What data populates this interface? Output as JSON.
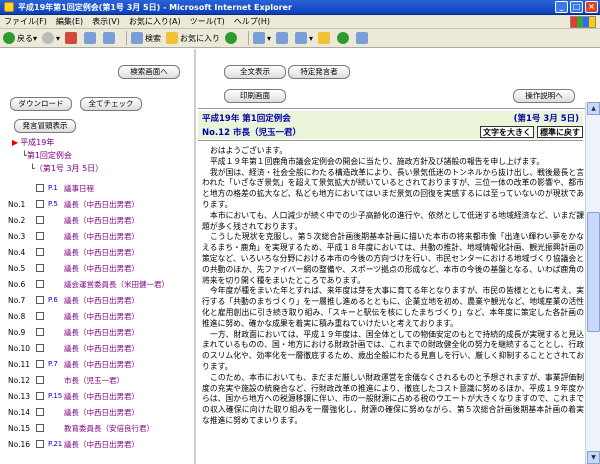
{
  "window": {
    "title": "平成19年第1回定例会(第1号 3月 5日) - Microsoft Internet Explorer"
  },
  "menu": [
    "ファイル(F)",
    "編集(E)",
    "表示(V)",
    "お気に入り(A)",
    "ツール(T)",
    "ヘルプ(H)"
  ],
  "toolbar": {
    "back": "戻る",
    "search": "検索",
    "favorites": "お気に入り"
  },
  "left": {
    "search_screen_btn": "検索画面へ",
    "download_btn": "ダウンロード",
    "check_all_btn": "全てチェック",
    "speaker_list_btn": "発言冒頭表示",
    "tree_year": "平成19年",
    "tree_session": "第1回定例会",
    "tree_date": "（第1号 3月 5日）",
    "rows": [
      {
        "no": "",
        "page": "P.1",
        "name": "議事日程"
      },
      {
        "no": "No.1",
        "page": "P.5",
        "name": "議長（中西日出男君）"
      },
      {
        "no": "No.2",
        "page": "",
        "name": "議長（中西日出男君）"
      },
      {
        "no": "No.3",
        "page": "",
        "name": "議長（中西日出男君）"
      },
      {
        "no": "No.4",
        "page": "",
        "name": "議長（中西日出男君）"
      },
      {
        "no": "No.5",
        "page": "",
        "name": "議長（中西日出男君）"
      },
      {
        "no": "No.6",
        "page": "",
        "name": "議会運営委員長（米田健一君）"
      },
      {
        "no": "No.7",
        "page": "P.6",
        "name": "議長（中西日出男君）"
      },
      {
        "no": "No.8",
        "page": "",
        "name": "議長（中西日出男君）"
      },
      {
        "no": "No.9",
        "page": "",
        "name": "議長（中西日出男君）"
      },
      {
        "no": "No.10",
        "page": "",
        "name": "議長（中西日出男君）"
      },
      {
        "no": "No.11",
        "page": "P.7",
        "name": "議長（中西日出男君）"
      },
      {
        "no": "No.12",
        "page": "",
        "name": "市長（児玉一君）"
      },
      {
        "no": "No.13",
        "page": "P.15",
        "name": "議長（中西日出男君）"
      },
      {
        "no": "No.14",
        "page": "",
        "name": "議長（中西日出男君）"
      },
      {
        "no": "No.15",
        "page": "",
        "name": "教育委員長（安倍良行君）"
      },
      {
        "no": "No.16",
        "page": "P.21",
        "name": "議長（中西日出男君）"
      }
    ]
  },
  "right": {
    "show_all_btn": "全文表示",
    "specific_speaker_btn": "特定発言者",
    "print_btn": "印刷画面",
    "help_btn": "操作説明へ",
    "session_title": "平成19年 第1回定例会",
    "session_date": "(第1号 3月 5日)",
    "speech_header": "No.12 市長（児玉一君）",
    "text_bigger": "文字を大きく",
    "text_normal": "標準に戻す",
    "paragraphs": [
      "おはようございます。",
      "平成１９年第１回鹿角市議会定例会の開会に当たり、施政方針及び諸般の報告を申し上げます。",
      "我が国は、経済・社会全般にわたる構造改革により、長い景気低迷のトンネルから抜け出し、戦後最長と言われた「いざなぎ景気」を超えて景気拡大が続いているとされておりますが、三位一体の改革の影響や、都市と地方の格差の拡大など、私ども地方においてはいまだ景気の回復を実感するには至っていないのが現状であります。",
      "本市においても、人口減少が続く中での少子高齢化の進行や、依然として低迷する地域経済など、いまだ課題が多く残されております。",
      "こうした現状を克服し、第５次総合計画後期基本計画に描いた本市の将来都市像「出逢い輝わい夢をかなえるまち・鹿角」を実現するため、平成１８年度においては、共動の推計、地域情報化計画、観光振興計画の策定など、いろいろな分野における本市の今後の方向づけを行い、市民センターにおける地域づくり協議会との共動のほか、先ファイバー網の整備や、スポーツ拠点の形成など、本市の今後の基盤となる、いわば鹿角の将来を切り開く種をまいたところであります。",
      "今年度が種をまいた年とすれば、来年度は芽を大事に育てる年となりますが、市民の皆様とともに考え、実行する「共動のまちづくり」を一層推し進めるとともに、企業立地を初め、農業や観光など、地域産業の活性化と雇用創出に引き続き取り組み、「スキーと駅伝を核にしたまちづくり」など、本年度に策定した各計画の推進に努め、確かな成果を着実に積み重ねていけたいと考えております。",
      "一方、財政面においては、平成１９年度は、国全体としての物価安定のもとで持続的成長が実現すると見込まれているものの、国・地方における財政計画では、これまでの財政健全化の努力を継続することとし、行政のスリム化や、効率化を一層徹底するため、歳出全般にわたる見直しを行い、厳しく抑制することとされております。",
      "このため、本市においても、まだまだ厳しい財政運営を余儀なくされるものと予想されますが、事業評価制度の充実や施設の統廃合など、行財政改革の推進により、徹底したコスト意識に努めるほか、平成１９年度からは、国から地方への税源移譲に伴い、市の一般財源に占める税のウエートが大きくなりますので、これまでの収入確保に向けた取り組みを一層強化し、財源の確保に努めながら、第５次総合計画後期基本計画の着実な推進に努めてまいります。"
    ]
  }
}
